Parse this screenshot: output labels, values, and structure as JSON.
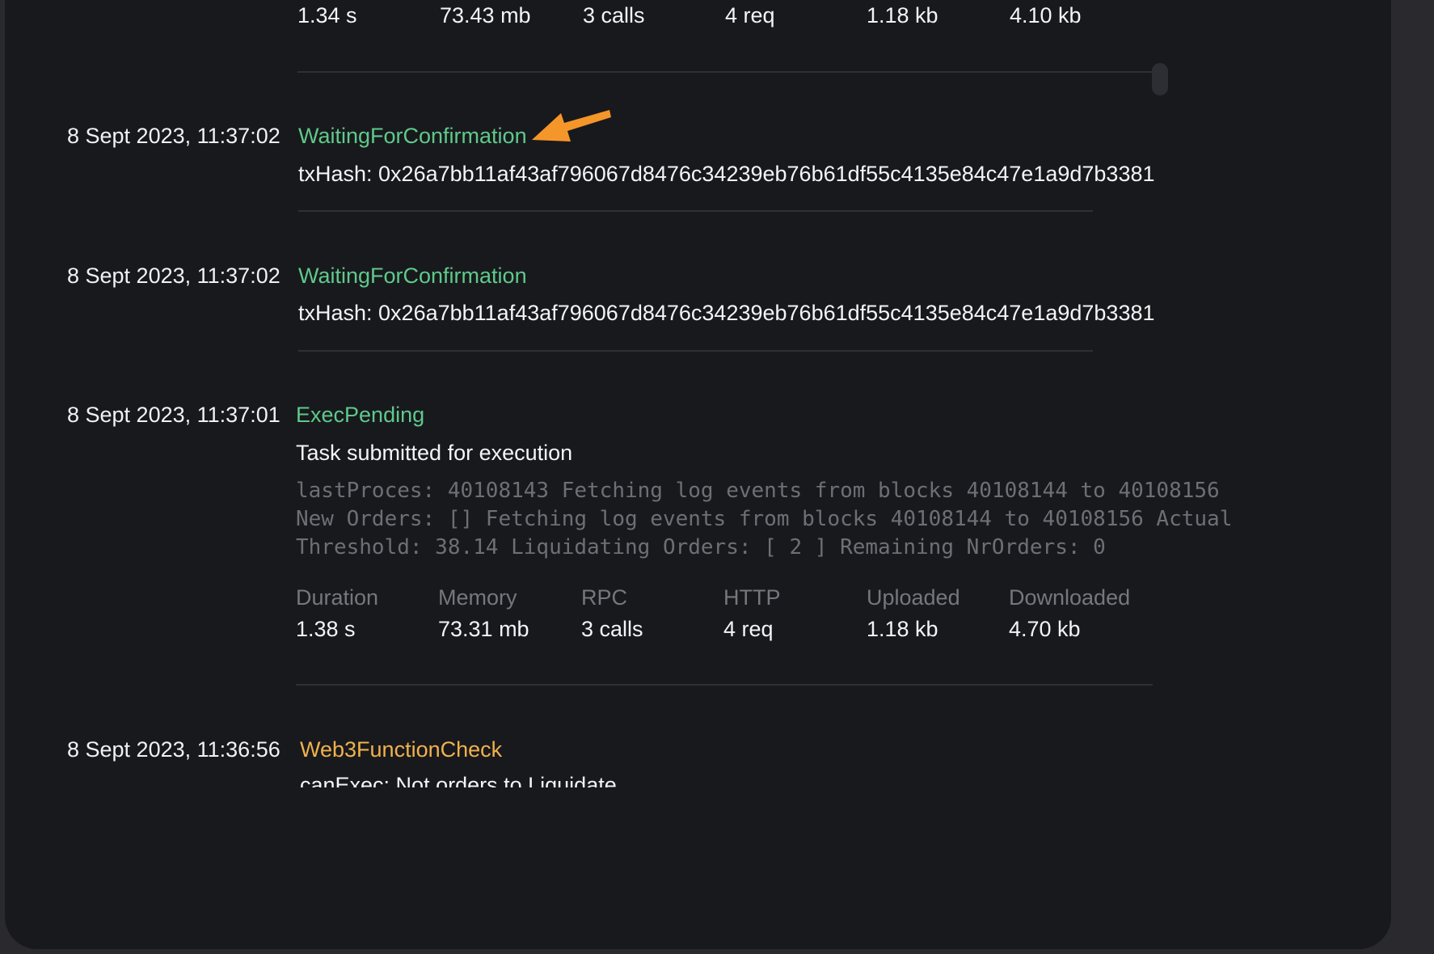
{
  "top_stats": {
    "duration": "1.34 s",
    "memory": "73.43 mb",
    "rpc": "3 calls",
    "http": "4 req",
    "uploaded": "1.18 kb",
    "downloaded": "4.10 kb"
  },
  "entries": [
    {
      "timestamp": "8 Sept 2023, 11:37:02",
      "status": "WaitingForConfirmation",
      "message": "txHash: 0x26a7bb11af43af796067d8476c34239eb76b61df55c4135e84c47e1a9d7b3381"
    },
    {
      "timestamp": "8 Sept 2023, 11:37:02",
      "status": "WaitingForConfirmation",
      "message": "txHash: 0x26a7bb11af43af796067d8476c34239eb76b61df55c4135e84c47e1a9d7b3381"
    },
    {
      "timestamp": "8 Sept 2023, 11:37:01",
      "status": "ExecPending",
      "message": "Task submitted for execution",
      "log_lines": [
        "lastProces: 40108143 Fetching log events from blocks 40108144 to 40108156",
        "New Orders: [] Fetching log events from blocks 40108144 to 40108156 Actual",
        "Threshold: 38.14 Liquidating Orders: [ 2 ] Remaining NrOrders: 0"
      ],
      "stats": {
        "labels": [
          "Duration",
          "Memory",
          "RPC",
          "HTTP",
          "Uploaded",
          "Downloaded"
        ],
        "values": [
          "1.38 s",
          "73.31 mb",
          "3 calls",
          "4 req",
          "1.18 kb",
          "4.70 kb"
        ]
      }
    },
    {
      "timestamp": "8 Sept 2023, 11:36:56",
      "status": "Web3FunctionCheck",
      "message": "canExec: Not orders to Liquidate"
    }
  ],
  "colors": {
    "status_green": "#5fc98a",
    "status_yellow": "#f0b24c",
    "arrow": "#f5962a",
    "background": "#18191d"
  }
}
